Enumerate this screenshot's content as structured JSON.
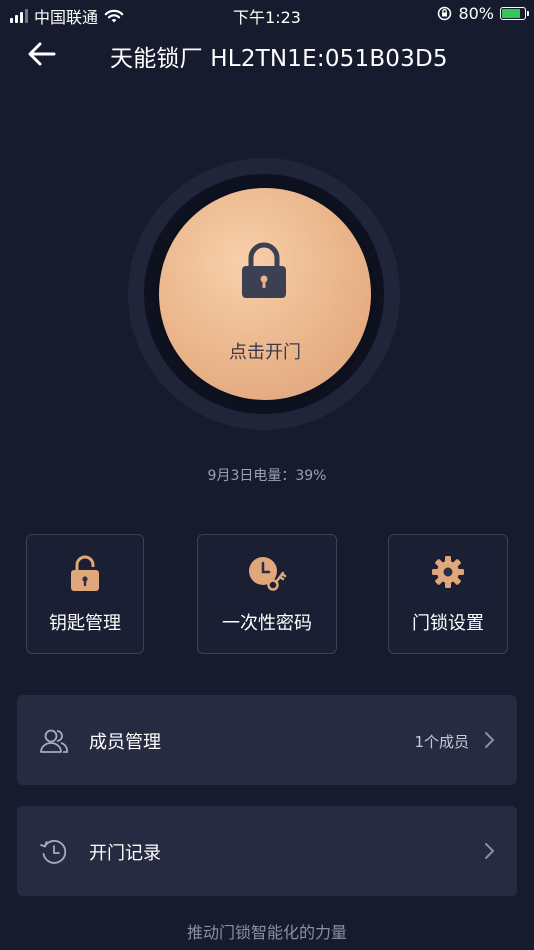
{
  "status_bar": {
    "carrier": "中国联通",
    "time": "下午1:23",
    "battery": "80%"
  },
  "nav": {
    "title": "天能锁厂 HL2TN1E:051B03D5"
  },
  "unlock": {
    "label": "点击开门"
  },
  "battery_info": "9月3日电量：39%",
  "tiles": [
    {
      "label": "钥匙管理",
      "icon": "padlock-icon"
    },
    {
      "label": "一次性密码",
      "icon": "clock-key-icon"
    },
    {
      "label": "门锁设置",
      "icon": "gear-icon"
    }
  ],
  "rows": [
    {
      "label": "成员管理",
      "value": "1个成员",
      "icon": "members-icon"
    },
    {
      "label": "开门记录",
      "value": "",
      "icon": "history-icon"
    }
  ],
  "footer": "推动门锁智能化的力量",
  "colors": {
    "background": "#171b2e",
    "accent_gold": "#eab48a",
    "card": "#262b42"
  }
}
